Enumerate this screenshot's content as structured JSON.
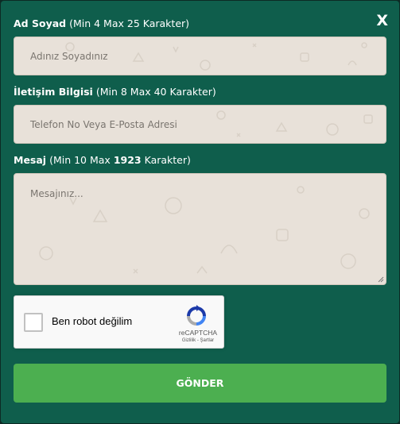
{
  "close_label": "X",
  "fields": {
    "name": {
      "label": "Ad Soyad",
      "hint": "(Min 4 Max 25 Karakter)",
      "placeholder": "Adınız Soyadınız"
    },
    "contact": {
      "label": "İletişim Bilgisi",
      "hint": "(Min 8 Max 40 Karakter)",
      "placeholder": "Telefon No Veya E-Posta Adresi"
    },
    "message": {
      "label": "Mesaj",
      "hint_prefix": "(Min 10 Max",
      "hint_max": "1923",
      "hint_suffix": "Karakter)",
      "placeholder": "Mesajınız..."
    }
  },
  "recaptcha": {
    "checkbox_label": "Ben robot değilim",
    "brand": "reCAPTCHA",
    "links": "Gizlilik - Şartlar"
  },
  "submit_label": "GÖNDER",
  "icons": {
    "close": "close-icon",
    "recaptcha": "recaptcha-logo-icon",
    "resize": "resize-handle-icon"
  },
  "colors": {
    "modal_bg": "#0f5e4c",
    "field_bg": "#e8e1d9",
    "submit_bg": "#4caf50"
  }
}
